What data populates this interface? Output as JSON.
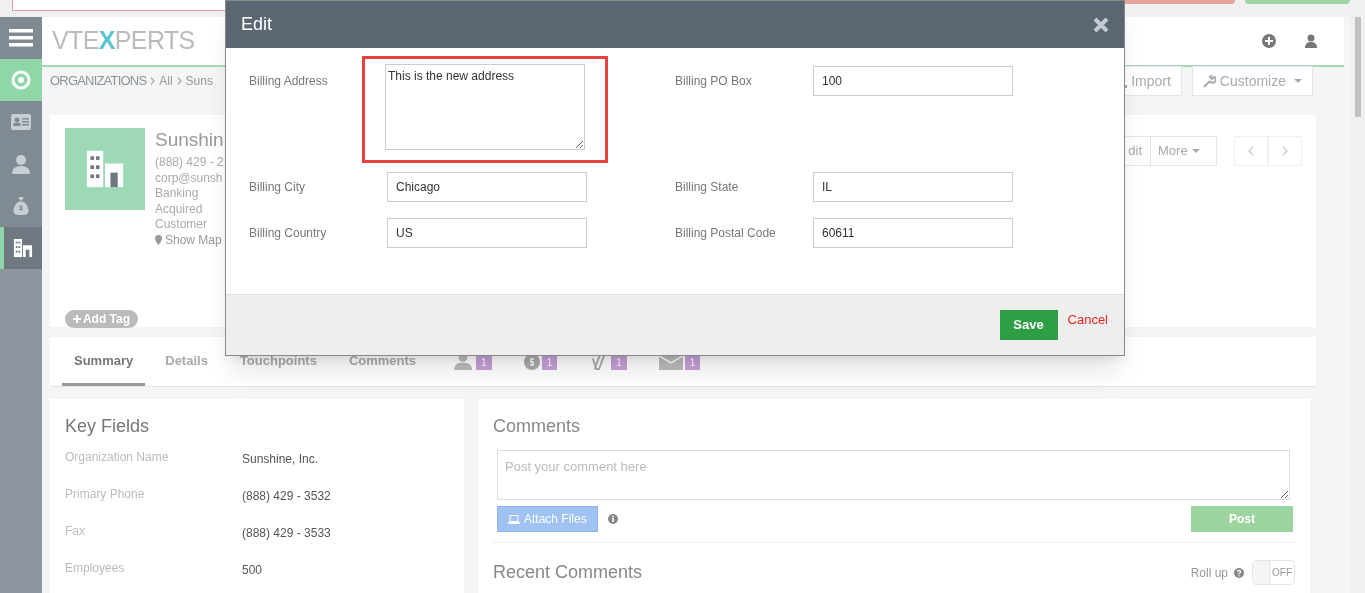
{
  "header": {
    "logo_left": "VTE",
    "logo_x": "X",
    "logo_right": "PERTS"
  },
  "sidebar": {
    "items": [
      {
        "kind": "target",
        "selected": false
      },
      {
        "kind": "contacts",
        "selected": false
      },
      {
        "kind": "person",
        "selected": false
      },
      {
        "kind": "money",
        "selected": false
      },
      {
        "kind": "building",
        "selected": true
      }
    ]
  },
  "breadcrumb": {
    "module": "ORGANIZATIONS",
    "items": [
      "All",
      "Suns"
    ]
  },
  "toolbar": {
    "buttons": [
      "Import",
      "Customize"
    ]
  },
  "record": {
    "name": "Sunshin",
    "details": [
      "(888) 429 - 2",
      "corp@sunsh",
      "Banking",
      "Acquired",
      "Customer"
    ],
    "map_link": "Show Map",
    "add_tag": "Add Tag",
    "actions": [
      "dit",
      "More"
    ]
  },
  "tabs": [
    {
      "label": "Summary",
      "selected": true
    },
    {
      "label": "Details",
      "selected": false
    },
    {
      "label": "Touchpoints",
      "selected": false
    },
    {
      "label": "Comments",
      "selected": false
    }
  ],
  "related": [
    {
      "kind": "person",
      "count": "1"
    },
    {
      "kind": "money",
      "count": "1"
    },
    {
      "kind": "clip",
      "count": "1"
    },
    {
      "kind": "mail",
      "count": "1"
    }
  ],
  "key_fields": {
    "title": "Key Fields",
    "rows": [
      {
        "label": "Organization Name",
        "value": "Sunshine, Inc."
      },
      {
        "label": "Primary Phone",
        "value": "(888) 429 - 3532"
      },
      {
        "label": "Fax",
        "value": "(888) 429 - 3533"
      },
      {
        "label": "Employees",
        "value": "500"
      }
    ]
  },
  "comments": {
    "title": "Comments",
    "placeholder": "Post your comment here",
    "attach": "Attach Files",
    "post": "Post",
    "recent_title": "Recent Comments",
    "roll_up": "Roll up",
    "roll_up_toggle": {
      "on": false,
      "label": "OFF"
    }
  },
  "modal": {
    "title": "Edit",
    "fields": [
      {
        "label": "Billing Address",
        "value": "This is the new address",
        "kind": "textarea",
        "highlighted": true
      },
      {
        "label": "Billing PO Box",
        "value": "100",
        "kind": "input",
        "highlighted": false
      },
      {
        "label": "Billing City",
        "value": "Chicago",
        "kind": "input",
        "highlighted": false
      },
      {
        "label": "Billing State",
        "value": "IL",
        "kind": "input",
        "highlighted": false
      },
      {
        "label": "Billing Country",
        "value": "US",
        "kind": "input",
        "highlighted": false
      },
      {
        "label": "Billing Postal Code",
        "value": "60611",
        "kind": "input",
        "highlighted": false
      }
    ],
    "save": "Save",
    "cancel": "Cancel"
  }
}
